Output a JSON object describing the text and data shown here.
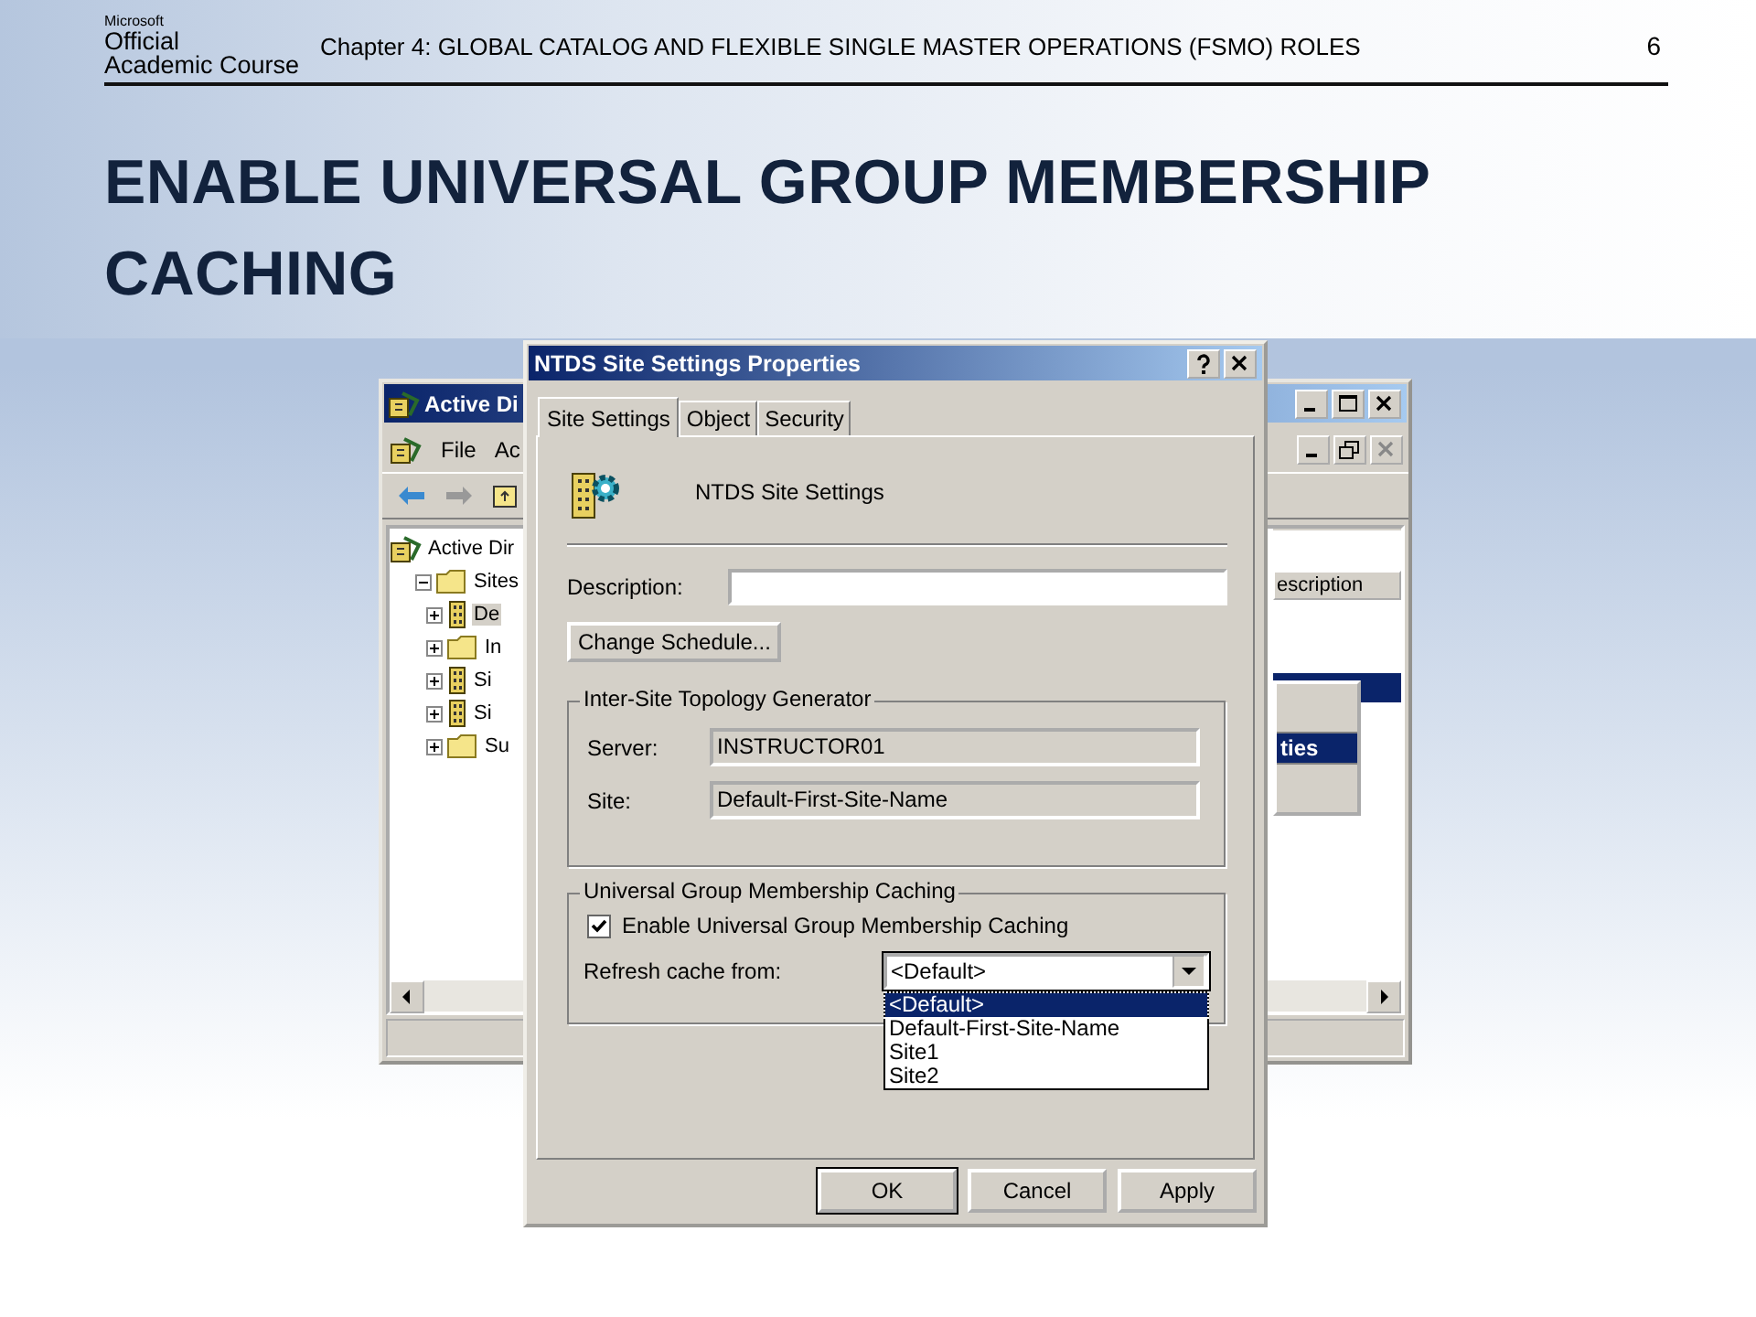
{
  "slide": {
    "logo": {
      "brand": "Microsoft",
      "line1": "Official",
      "line2": "Academic Course"
    },
    "header": "Chapter 4: GLOBAL CATALOG AND FLEXIBLE SINGLE MASTER OPERATIONS (FSMO) ROLES",
    "page_number": "6",
    "title": "ENABLE UNIVERSAL GROUP MEMBERSHIP CACHING"
  },
  "background_window": {
    "title": "Active Di",
    "menu": [
      "File",
      "Ac"
    ],
    "tree": [
      {
        "label": "Active Dir",
        "kind": "snapin",
        "selected": false,
        "children": [
          {
            "label": "Sites",
            "kind": "folder",
            "expanded": true,
            "selected": false,
            "children": [
              {
                "label": "De",
                "kind": "site",
                "expanded": false,
                "selected": true
              },
              {
                "label": "In",
                "kind": "folder",
                "expanded": false,
                "selected": false
              },
              {
                "label": "Si",
                "kind": "site",
                "expanded": false,
                "selected": false
              },
              {
                "label": "Si",
                "kind": "site",
                "expanded": false,
                "selected": false
              },
              {
                "label": "Su",
                "kind": "folder",
                "expanded": false,
                "selected": false
              }
            ]
          }
        ]
      }
    ],
    "column_header": "escription",
    "rows": [
      {
        "selected": true
      }
    ],
    "context_menu": [
      {
        "label": "ties",
        "selected": true
      }
    ]
  },
  "dialog": {
    "title": "NTDS Site Settings Properties",
    "tabs": [
      {
        "label": "Site Settings",
        "selected": true
      },
      {
        "label": "Object",
        "selected": false
      },
      {
        "label": "Security",
        "selected": false
      }
    ],
    "heading": "NTDS Site Settings",
    "description_label": "Description:",
    "change_schedule_button": "Change Schedule...",
    "topology_group": {
      "title": "Inter-Site Topology Generator",
      "fields": [
        {
          "label": "Server:",
          "value": "INSTRUCTOR01",
          "disabled": true
        },
        {
          "label": "Site:",
          "value": "Default-First-Site-Name",
          "disabled": true
        }
      ]
    },
    "caching_group": {
      "title": "Universal Group Membership Caching",
      "checkbox": {
        "label": "Enable Universal Group Membership Caching",
        "checked": true
      },
      "refresh": {
        "label": "Refresh cache from:",
        "value": "<Default>",
        "expanded": true,
        "options": [
          {
            "label": "<Default>",
            "selected": true
          },
          {
            "label": "Default-First-Site-Name",
            "selected": false
          },
          {
            "label": "Site1",
            "selected": false
          },
          {
            "label": "Site2",
            "selected": false
          }
        ]
      }
    },
    "buttons": [
      {
        "label": "OK",
        "default": true
      },
      {
        "label": "Cancel",
        "default": false
      },
      {
        "label": "Apply",
        "default": false
      }
    ]
  }
}
